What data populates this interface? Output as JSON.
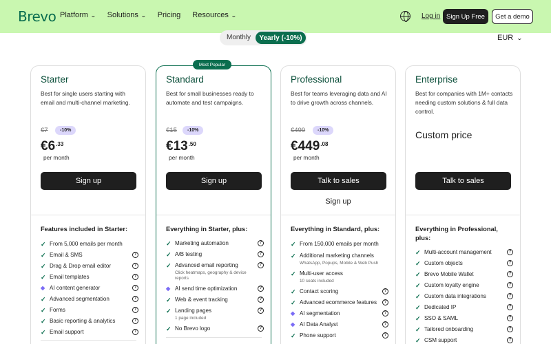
{
  "header": {
    "logo": "Brevo",
    "nav": [
      {
        "label": "Platform",
        "dropdown": true
      },
      {
        "label": "Solutions",
        "dropdown": true
      },
      {
        "label": "Pricing",
        "dropdown": false
      },
      {
        "label": "Resources",
        "dropdown": true
      }
    ],
    "login": "Log in",
    "signup": "Sign Up Free",
    "demo": "Get a demo"
  },
  "billing": {
    "monthly": "Monthly",
    "yearly": "Yearly (-10%)",
    "currency": "EUR"
  },
  "popular_badge": "Most Popular",
  "plans": [
    {
      "name": "Starter",
      "description": "Best for single users starting with email and multi-channel marketing.",
      "old_price": "€7",
      "discount": "-10%",
      "price_main": "€6",
      "price_cents": ".33",
      "per": "per month",
      "cta": "Sign up",
      "features_title": "Features included in Starter:",
      "features": [
        {
          "text": "From 5,000 emails per month",
          "info": false,
          "mark": "check"
        },
        {
          "text": "Email & SMS",
          "info": true,
          "mark": "check"
        },
        {
          "text": "Drag & Drop email editor",
          "info": true,
          "mark": "check"
        },
        {
          "text": "Email templates",
          "info": true,
          "mark": "check"
        },
        {
          "text": "AI content generator",
          "info": true,
          "mark": "diamond"
        },
        {
          "text": "Advanced segmentation",
          "info": true,
          "mark": "check"
        },
        {
          "text": "Forms",
          "info": true,
          "mark": "check"
        },
        {
          "text": "Basic reporting & analytics",
          "info": true,
          "mark": "check"
        },
        {
          "text": "Email support",
          "info": true,
          "mark": "check"
        }
      ]
    },
    {
      "name": "Standard",
      "description": "Best for small businesses ready to automate and test campaigns.",
      "old_price": "€15",
      "discount": "-10%",
      "price_main": "€13",
      "price_cents": ".50",
      "per": "per month",
      "cta": "Sign up",
      "features_title": "Everything in Starter, plus:",
      "features": [
        {
          "text": "Marketing automation",
          "info": true,
          "mark": "check"
        },
        {
          "text": "A/B testing",
          "info": true,
          "mark": "check"
        },
        {
          "text": "Advanced email reporting",
          "sub": "Click heatmaps, geography & device reports",
          "info": true,
          "mark": "check"
        },
        {
          "text": "AI send time optimization",
          "info": true,
          "mark": "diamond"
        },
        {
          "text": "Web & event tracking",
          "info": true,
          "mark": "check"
        },
        {
          "text": "Landing pages",
          "sub": "1 page included",
          "info": true,
          "mark": "check"
        },
        {
          "text": "No Brevo logo",
          "info": true,
          "mark": "check"
        }
      ]
    },
    {
      "name": "Professional",
      "description": "Best for teams leveraging data and AI to drive growth across channels.",
      "old_price": "€499",
      "discount": "-10%",
      "price_main": "€449",
      "price_cents": ".08",
      "per": "per month",
      "cta": "Talk to sales",
      "secondary": "Sign up",
      "features_title": "Everything in Standard, plus:",
      "features": [
        {
          "text": "From 150,000 emails per month",
          "info": false,
          "mark": "check"
        },
        {
          "text": "Additional marketing channels",
          "sub": "WhatsApp, Popups, Mobile & Web Push",
          "info": false,
          "mark": "check"
        },
        {
          "text": "Multi-user access",
          "sub": "10 seats included",
          "info": false,
          "mark": "check"
        },
        {
          "text": "Contact scoring",
          "info": true,
          "mark": "check"
        },
        {
          "text": "Advanced ecommerce features",
          "info": true,
          "mark": "check"
        },
        {
          "text": "AI segmentation",
          "info": true,
          "mark": "diamond"
        },
        {
          "text": "AI Data Analyst",
          "info": true,
          "mark": "diamond"
        },
        {
          "text": "Phone support",
          "info": true,
          "mark": "check"
        }
      ]
    },
    {
      "name": "Enterprise",
      "description": "Best for companies with 1M+ contacts needing custom solutions & full data control.",
      "custom_price": "Custom price",
      "cta": "Talk to sales",
      "features_title": "Everything in Professional, plus:",
      "features": [
        {
          "text": "Multi-account management",
          "info": true,
          "mark": "check"
        },
        {
          "text": "Custom objects",
          "info": true,
          "mark": "check"
        },
        {
          "text": "Brevo Mobile Wallet",
          "info": true,
          "mark": "check"
        },
        {
          "text": "Custom loyalty engine",
          "info": true,
          "mark": "check"
        },
        {
          "text": "Custom data integrations",
          "info": true,
          "mark": "check"
        },
        {
          "text": "Dedicated IP",
          "info": true,
          "mark": "check"
        },
        {
          "text": "SSO & SAML",
          "info": true,
          "mark": "check"
        },
        {
          "text": "Tailored onboarding",
          "info": true,
          "mark": "check"
        },
        {
          "text": "CSM support",
          "info": true,
          "mark": "check"
        }
      ]
    }
  ]
}
